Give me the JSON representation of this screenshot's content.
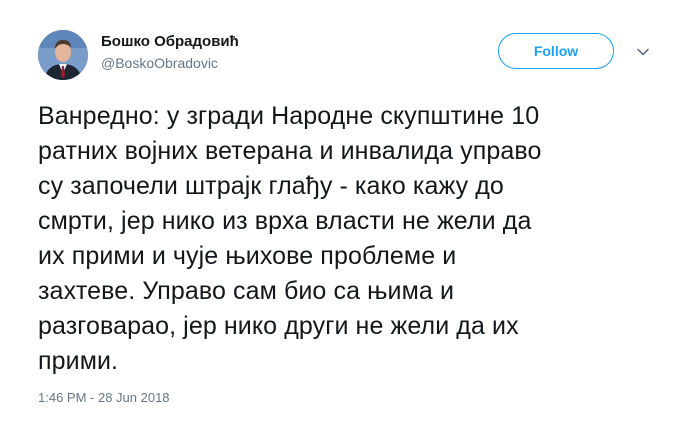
{
  "tweet": {
    "author": {
      "display_name": "Бошко Обрадовић",
      "handle": "@BoskoObradovic"
    },
    "follow_label": "Follow",
    "text_lines": [
      "Ванредно: у згради Народне скупштине 10",
      "ратних војних ветерана и инвалида управо",
      "су започели штрајк глађу - како кажу до",
      "смрти, јер нико из врха власти не жели да",
      "их прими и чује њихове проблеме и",
      "захтеве. Управо сам био са њима и",
      "разговарао, јер нико други не жели да их",
      "прими."
    ],
    "timestamp": "1:46 PM - 28 Jun 2018"
  },
  "icons": {
    "menu": "chevron-down-icon"
  },
  "colors": {
    "accent": "#1da1f2",
    "text": "#14171a",
    "secondary_text": "#657786",
    "background": "#ffffff"
  }
}
